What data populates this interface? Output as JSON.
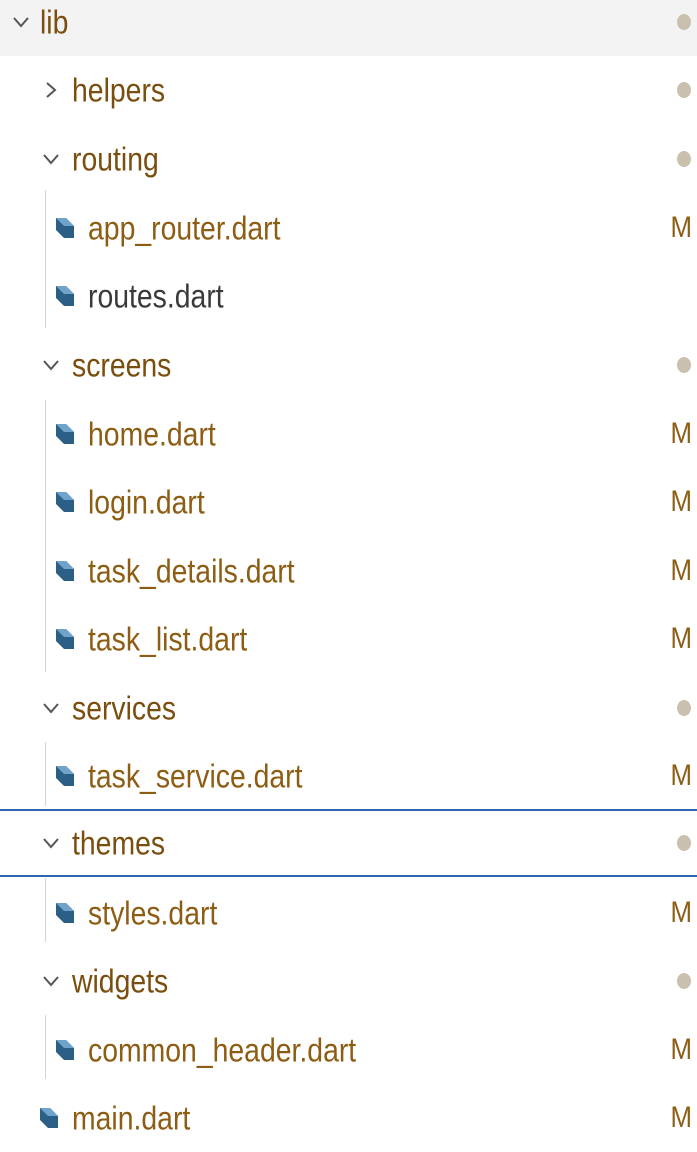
{
  "explorer": {
    "root": {
      "label": "lib",
      "expanded": true,
      "status": "dot"
    },
    "items": [
      {
        "label": "helpers",
        "type": "folder",
        "expanded": false,
        "status": "dot"
      },
      {
        "label": "routing",
        "type": "folder",
        "expanded": true,
        "status": "dot"
      },
      {
        "label": "app_router.dart",
        "type": "file",
        "status": "M"
      },
      {
        "label": "routes.dart",
        "type": "file",
        "status": ""
      },
      {
        "label": "screens",
        "type": "folder",
        "expanded": true,
        "status": "dot"
      },
      {
        "label": "home.dart",
        "type": "file",
        "status": "M"
      },
      {
        "label": "login.dart",
        "type": "file",
        "status": "M"
      },
      {
        "label": "task_details.dart",
        "type": "file",
        "status": "M"
      },
      {
        "label": "task_list.dart",
        "type": "file",
        "status": "M"
      },
      {
        "label": "services",
        "type": "folder",
        "expanded": true,
        "status": "dot"
      },
      {
        "label": "task_service.dart",
        "type": "file",
        "status": "M"
      },
      {
        "label": "themes",
        "type": "folder",
        "expanded": true,
        "status": "dot",
        "selected": true
      },
      {
        "label": "styles.dart",
        "type": "file",
        "status": "M"
      },
      {
        "label": "widgets",
        "type": "folder",
        "expanded": true,
        "status": "dot"
      },
      {
        "label": "common_header.dart",
        "type": "file",
        "status": "M"
      },
      {
        "label": "main.dart",
        "type": "file",
        "status": "M"
      }
    ]
  },
  "colors": {
    "folder_text": "#7a4e0e",
    "modified_text": "#8d5d14",
    "normal_text": "#3a3a3a",
    "selection_border": "#2f64b1",
    "dart_icon": "#2c5f86",
    "status_dot": "#c9c0ae"
  }
}
